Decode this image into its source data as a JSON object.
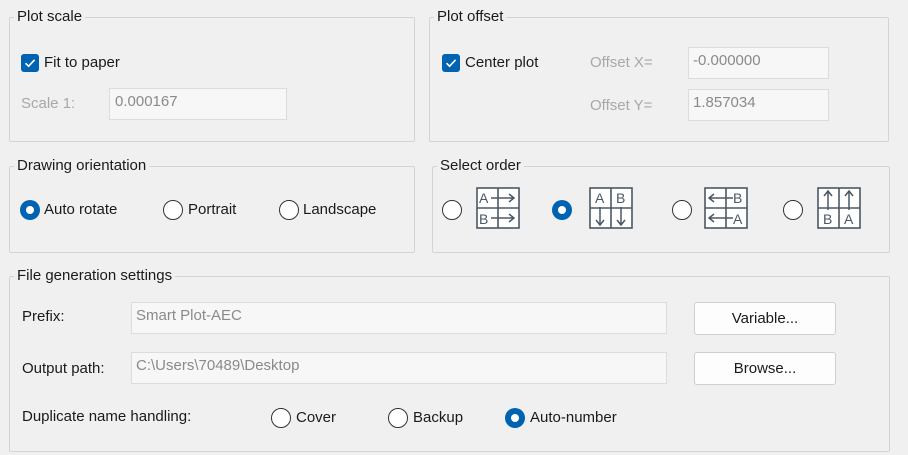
{
  "plot_scale": {
    "title": "Plot scale",
    "fit_to_paper_label": "Fit to paper",
    "fit_to_paper_checked": true,
    "scale_label": "Scale 1:",
    "scale_value": "0.000167"
  },
  "plot_offset": {
    "title": "Plot offset",
    "center_plot_label": "Center plot",
    "center_plot_checked": true,
    "offset_x_label": "Offset X=",
    "offset_x_value": "-0.000000",
    "offset_y_label": "Offset Y=",
    "offset_y_value": "1.857034"
  },
  "drawing_orientation": {
    "title": "Drawing orientation",
    "options": [
      "Auto rotate",
      "Portrait",
      "Landscape"
    ],
    "selected": "Auto rotate"
  },
  "select_order": {
    "title": "Select order",
    "options": [
      {
        "icon": "order-horizontal-rows-icon",
        "letters": [
          "A",
          "B"
        ]
      },
      {
        "icon": "order-vertical-columns-down-icon",
        "letters": [
          "A",
          "B"
        ]
      },
      {
        "icon": "order-horizontal-reverse-icon",
        "letters": [
          "B",
          "A"
        ]
      },
      {
        "icon": "order-vertical-columns-up-icon",
        "letters": [
          "B",
          "A"
        ]
      }
    ],
    "selected_index": 1
  },
  "file_generation": {
    "title": "File generation settings",
    "prefix_label": "Prefix:",
    "prefix_value": "Smart Plot-AEC",
    "variable_button": "Variable...",
    "output_path_label": "Output path:",
    "output_path_value": "C:\\Users\\70489\\Desktop",
    "browse_button": "Browse...",
    "duplicate_label": "Duplicate name handling:",
    "duplicate_options": [
      "Cover",
      "Backup",
      "Auto-number"
    ],
    "duplicate_selected": "Auto-number"
  },
  "colors": {
    "accent": "#0063b1",
    "background": "#f0f0f0",
    "icon_stroke": "#4a5866"
  }
}
